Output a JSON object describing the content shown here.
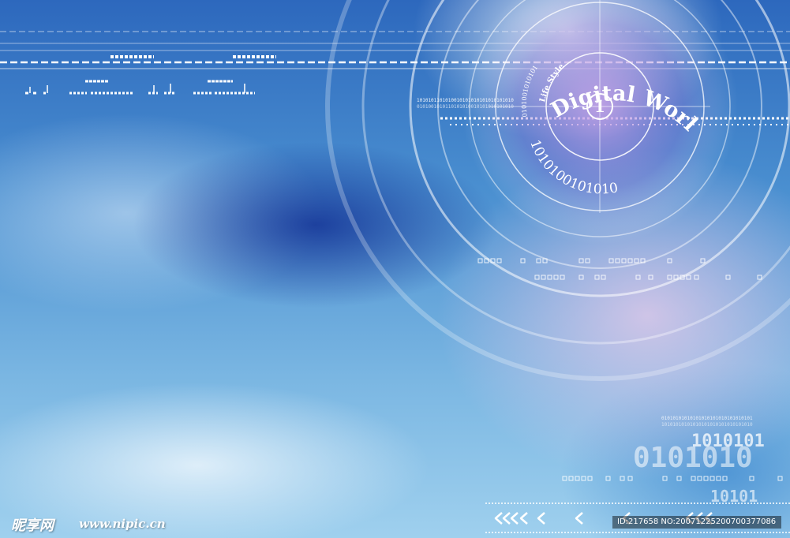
{
  "artwork": {
    "arc_title": "Digital World",
    "arc_subtitle": "Life Style",
    "center_numeral": "1",
    "binary_arc": "1010100101010",
    "inner_binary_arc": "0101001010101",
    "big_binary_row1": "1010101",
    "big_binary_row2": "0101010",
    "big_binary_row3": "10101",
    "tiny_binary_row1": "1010101101010010101010101010101010",
    "tiny_binary_row2": "0101001010110101010010101010101010",
    "tiny_binary_br1": "01010101010101010101010101010101",
    "tiny_binary_br2": "10101010101010101010101010101010"
  },
  "watermark": {
    "site_logo": "昵享网",
    "site_url": "www.nipic.cn",
    "image_id": "ID:217658 NO:20071225200700377086"
  },
  "colors": {
    "sky_dark": "#2d68bd",
    "sky_light": "#9fd0ee",
    "accent_purple": "#c9a0e6",
    "line_white": "#ffffff"
  }
}
